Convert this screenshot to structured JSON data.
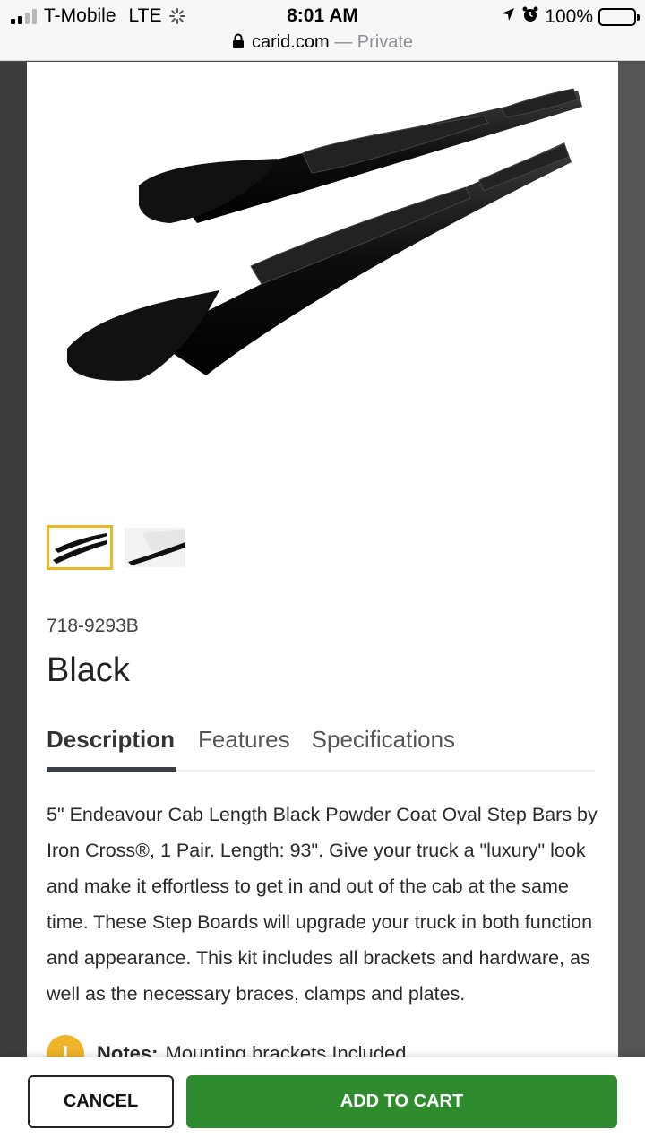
{
  "status_bar": {
    "carrier": "T-Mobile",
    "network": "LTE",
    "time": "8:01 AM",
    "battery": "100%",
    "battery_level": 1.0,
    "signal_bars_on": 2,
    "signal_bars_total": 4
  },
  "address_bar": {
    "domain": "carid.com",
    "separator": "—",
    "mode": "Private"
  },
  "product": {
    "image_icon": "step-bars-product-image",
    "thumbnails": [
      {
        "name": "step-bars-thumbnail",
        "active": true
      },
      {
        "name": "installed-on-truck-thumbnail",
        "active": false
      }
    ],
    "part_number": "718-9293B",
    "variant": "Black"
  },
  "tabs": [
    {
      "label": "Description",
      "active": true
    },
    {
      "label": "Features",
      "active": false
    },
    {
      "label": "Specifications",
      "active": false
    }
  ],
  "description": "5\" Endeavour Cab Length Black Powder Coat Oval Step Bars by Iron Cross®, 1 Pair. Length: 93\". Give your truck a \"luxury\" look and make it effortless to get in and out of the cab at the same time. These Step Boards will upgrade your truck in both function and appearance. This kit includes all brackets and hardware, as well as the necessary braces, clamps and plates.",
  "notes": {
    "icon": "!",
    "label": "Notes:",
    "text": "Mounting brackets Included"
  },
  "actions": {
    "cancel_label": "CANCEL",
    "add_to_cart_label": "ADD TO CART"
  },
  "colors": {
    "accent_green": "#2e8b2e",
    "thumbnail_highlight": "#f0b429"
  }
}
